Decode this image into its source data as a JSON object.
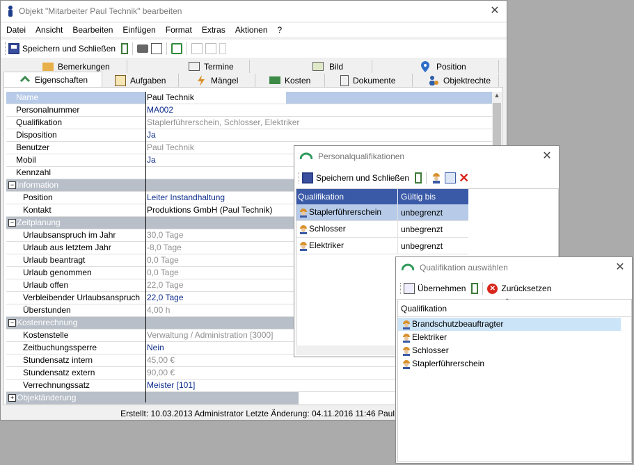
{
  "main_window": {
    "title": "Objekt \"Mitarbeiter Paul Technik\" bearbeiten",
    "menu": [
      "Datei",
      "Ansicht",
      "Bearbeiten",
      "Einfügen",
      "Format",
      "Extras",
      "Aktionen",
      "?"
    ],
    "toolbar": {
      "save_close_label": "Speichern und Schließen"
    },
    "tabs_row1": [
      "Bemerkungen",
      "Termine",
      "Bild",
      "Position"
    ],
    "tabs_row2": [
      "Eigenschaften",
      "Aufgaben",
      "Mängel",
      "Kosten",
      "Dokumente",
      "Objektrechte"
    ],
    "properties": [
      {
        "key": "Name",
        "value": "Paul Technik",
        "style": "selected"
      },
      {
        "key": "Personalnummer",
        "value": "MA002",
        "style": "blue"
      },
      {
        "key": "Qualifikation",
        "value": "Staplerführerschein, Schlosser, Elektriker",
        "style": "gray"
      },
      {
        "key": "Disposition",
        "value": "Ja",
        "style": "blue"
      },
      {
        "key": "Benutzer",
        "value": "Paul Technik",
        "style": "gray"
      },
      {
        "key": "Mobil",
        "value": "Ja",
        "style": "blue"
      },
      {
        "key": "Kennzahl",
        "value": "",
        "style": "plain"
      },
      {
        "key": "Information",
        "value": "",
        "style": "group",
        "sign": "−"
      },
      {
        "key": "Position",
        "value": "Leiter Instandhaltung",
        "style": "blue",
        "indent": true
      },
      {
        "key": "Kontakt",
        "value": "Produktions GmbH  (Paul Technik)",
        "style": "plain",
        "indent": true
      },
      {
        "key": "Zeitplanung",
        "value": "",
        "style": "group",
        "sign": "−"
      },
      {
        "key": "Urlaubsanspruch im Jahr",
        "value": "30,0 Tage",
        "style": "gray",
        "indent": true
      },
      {
        "key": "Urlaub aus letztem Jahr",
        "value": "-8,0 Tage",
        "style": "gray",
        "indent": true
      },
      {
        "key": "Urlaub beantragt",
        "value": "0,0 Tage",
        "style": "gray",
        "indent": true
      },
      {
        "key": "Urlaub genommen",
        "value": "0,0 Tage",
        "style": "gray",
        "indent": true
      },
      {
        "key": "Urlaub offen",
        "value": "22,0 Tage",
        "style": "gray",
        "indent": true
      },
      {
        "key": "Verbleibender Urlaubsanspruch",
        "value": "22,0 Tage",
        "style": "blue",
        "indent": true
      },
      {
        "key": "Überstunden",
        "value": "4,00 h",
        "style": "gray",
        "indent": true
      },
      {
        "key": "Kostenrechnung",
        "value": "",
        "style": "group",
        "sign": "−"
      },
      {
        "key": "Kostenstelle",
        "value": "Verwaltung / Administration [3000]",
        "style": "gray",
        "indent": true
      },
      {
        "key": "Zeitbuchungssperre",
        "value": "Nein",
        "style": "blue",
        "indent": true
      },
      {
        "key": "Stundensatz intern",
        "value": "45,00 €",
        "style": "gray",
        "indent": true
      },
      {
        "key": "Stundensatz extern",
        "value": "90,00 €",
        "style": "gray",
        "indent": true
      },
      {
        "key": "Verrechnungssatz",
        "value": "Meister [101]",
        "style": "blue",
        "indent": true
      },
      {
        "key": "Objektänderung",
        "value": "",
        "style": "group",
        "sign": "+"
      }
    ],
    "status": "Erstellt: 10.03.2013 Administrator  Letzte Änderung: 04.11.2016 11:46 Paul"
  },
  "pq_window": {
    "title": "Personalqualifikationen",
    "save_close_label": "Speichern und Schließen",
    "headers": [
      "Qualifikation",
      "Gültig bis"
    ],
    "rows": [
      {
        "qual": "Staplerführerschein",
        "until": "unbegrenzt"
      },
      {
        "qual": "Schlosser",
        "until": "unbegrenzt"
      },
      {
        "qual": "Elektriker",
        "until": "unbegrenzt"
      }
    ]
  },
  "qa_window": {
    "title": "Qualifikation auswählen",
    "apply_label": "Übernehmen",
    "reset_label": "Zurücksetzen",
    "header": "Qualifikation",
    "items": [
      "Brandschutzbeauftragter",
      "Elektriker",
      "Schlosser",
      "Staplerführerschein"
    ]
  },
  "colors": {
    "accent_blue": "#0c2c8c",
    "group_bg": "#b8bfc8",
    "selection": "#b7cbe8",
    "list_selection": "#cce4f7",
    "delete_red": "#d9261c"
  }
}
